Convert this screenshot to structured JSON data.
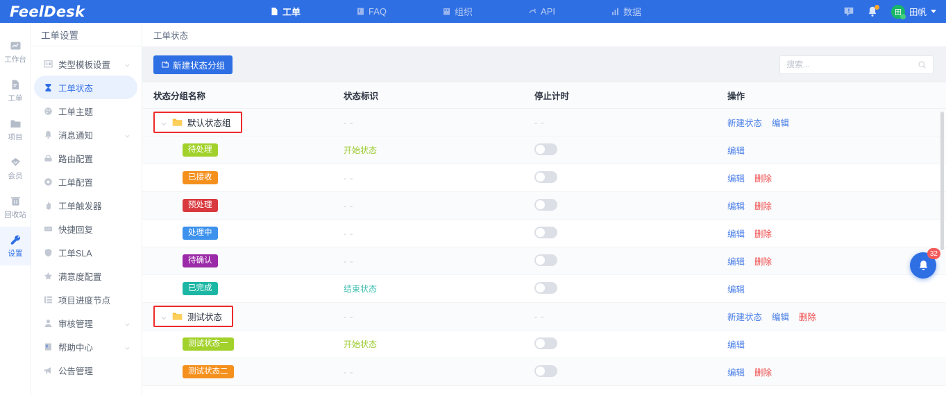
{
  "brand": "FeelDesk",
  "topnav": {
    "items": [
      {
        "label": "工单",
        "icon": "document-icon",
        "active": true
      },
      {
        "label": "FAQ",
        "icon": "book-icon",
        "active": false
      },
      {
        "label": "组织",
        "icon": "building-icon",
        "active": false
      },
      {
        "label": "API",
        "icon": "link-icon",
        "active": false
      },
      {
        "label": "数据",
        "icon": "chart-icon",
        "active": false
      }
    ],
    "feedback_icon": "feedback-icon",
    "bell_icon": "bell-icon",
    "user": {
      "avatar_text": "田",
      "name": "田帆"
    }
  },
  "rail": {
    "items": [
      {
        "label": "工作台",
        "icon": "dashboard-icon",
        "active": false
      },
      {
        "label": "工单",
        "icon": "ticket-icon",
        "active": false
      },
      {
        "label": "项目",
        "icon": "folder-icon",
        "active": false
      },
      {
        "label": "会员",
        "icon": "diamond-icon",
        "active": false
      },
      {
        "label": "回收站",
        "icon": "trash-icon",
        "active": false
      },
      {
        "label": "设置",
        "icon": "wrench-icon",
        "active": true
      }
    ]
  },
  "sidebar": {
    "title": "工单设置",
    "items": [
      {
        "label": "类型模板设置",
        "icon": "template-icon",
        "expandable": true,
        "active": false
      },
      {
        "label": "工单状态",
        "icon": "hourglass-icon",
        "expandable": false,
        "active": true
      },
      {
        "label": "工单主题",
        "icon": "palette-icon",
        "expandable": false,
        "active": false
      },
      {
        "label": "消息通知",
        "icon": "bell-icon",
        "expandable": true,
        "active": false
      },
      {
        "label": "路由配置",
        "icon": "route-icon",
        "expandable": false,
        "active": false
      },
      {
        "label": "工单配置",
        "icon": "gear-icon",
        "expandable": false,
        "active": false
      },
      {
        "label": "工单触发器",
        "icon": "hand-icon",
        "expandable": false,
        "active": false
      },
      {
        "label": "快捷回复",
        "icon": "reply-icon",
        "expandable": false,
        "active": false
      },
      {
        "label": "工单SLA",
        "icon": "shield-icon",
        "expandable": false,
        "active": false
      },
      {
        "label": "满意度配置",
        "icon": "star-icon",
        "expandable": false,
        "active": false
      },
      {
        "label": "项目进度节点",
        "icon": "list-icon",
        "expandable": false,
        "active": false
      },
      {
        "label": "审核管理",
        "icon": "user-icon",
        "expandable": true,
        "active": false
      },
      {
        "label": "帮助中心",
        "icon": "book-icon",
        "expandable": true,
        "active": false
      },
      {
        "label": "公告管理",
        "icon": "megaphone-icon",
        "expandable": false,
        "active": false
      }
    ]
  },
  "main": {
    "breadcrumb": "工单状态",
    "new_group_button": "新建状态分组",
    "search_placeholder": "搜索...",
    "columns": [
      "状态分组名称",
      "状态标识",
      "停止计时",
      "操作"
    ],
    "rows": [
      {
        "kind": "group",
        "name": "默认状态组",
        "highlight": true,
        "identifier": "- -",
        "identifier_color": "#c2c8d2",
        "has_switch": false,
        "actions": [
          {
            "label": "新建状态",
            "danger": false
          },
          {
            "label": "编辑",
            "danger": false
          }
        ]
      },
      {
        "kind": "status",
        "name": "待处理",
        "color": "#a2d12c",
        "identifier": "开始状态",
        "identifier_color": "#9ccb32",
        "has_switch": true,
        "switch_on": false,
        "actions": [
          {
            "label": "编辑",
            "danger": false
          }
        ]
      },
      {
        "kind": "status",
        "name": "已接收",
        "color": "#f5901d",
        "identifier": "- -",
        "identifier_color": "#c2c8d2",
        "has_switch": true,
        "switch_on": false,
        "actions": [
          {
            "label": "编辑",
            "danger": false
          },
          {
            "label": "删除",
            "danger": true
          }
        ]
      },
      {
        "kind": "status",
        "name": "预处理",
        "color": "#d93a3f",
        "identifier": "- -",
        "identifier_color": "#c2c8d2",
        "has_switch": true,
        "switch_on": false,
        "actions": [
          {
            "label": "编辑",
            "danger": false
          },
          {
            "label": "删除",
            "danger": true
          }
        ]
      },
      {
        "kind": "status",
        "name": "处理中",
        "color": "#3c92ec",
        "identifier": "- -",
        "identifier_color": "#c2c8d2",
        "has_switch": true,
        "switch_on": false,
        "actions": [
          {
            "label": "编辑",
            "danger": false
          },
          {
            "label": "删除",
            "danger": true
          }
        ]
      },
      {
        "kind": "status",
        "name": "待确认",
        "color": "#9b2aa8",
        "identifier": "- -",
        "identifier_color": "#c2c8d2",
        "has_switch": true,
        "switch_on": false,
        "actions": [
          {
            "label": "编辑",
            "danger": false
          },
          {
            "label": "删除",
            "danger": true
          }
        ]
      },
      {
        "kind": "status",
        "name": "已完成",
        "color": "#1cb7a4",
        "identifier": "结束状态",
        "identifier_color": "#3fbfb0",
        "has_switch": true,
        "switch_on": false,
        "actions": [
          {
            "label": "编辑",
            "danger": false
          }
        ]
      },
      {
        "kind": "group",
        "name": "测试状态",
        "highlight": true,
        "identifier": "- -",
        "identifier_color": "#c2c8d2",
        "has_switch": false,
        "actions": [
          {
            "label": "新建状态",
            "danger": false
          },
          {
            "label": "编辑",
            "danger": false
          },
          {
            "label": "删除",
            "danger": true
          }
        ]
      },
      {
        "kind": "status",
        "name": "测试状态一",
        "color": "#a2d12c",
        "identifier": "开始状态",
        "identifier_color": "#9ccb32",
        "has_switch": true,
        "switch_on": false,
        "actions": [
          {
            "label": "编辑",
            "danger": false
          }
        ]
      },
      {
        "kind": "status",
        "name": "测试状态二",
        "color": "#f5901d",
        "identifier": "- -",
        "identifier_color": "#c2c8d2",
        "has_switch": true,
        "switch_on": false,
        "actions": [
          {
            "label": "编辑",
            "danger": false
          },
          {
            "label": "删除",
            "danger": true
          }
        ]
      }
    ]
  },
  "fab": {
    "icon": "bell-icon",
    "badge": "32"
  },
  "colors": {
    "brand": "#2f6fe4",
    "danger": "#ef4b4b",
    "link": "#4a7fe8",
    "highlight_box": "#ee2b2b"
  }
}
